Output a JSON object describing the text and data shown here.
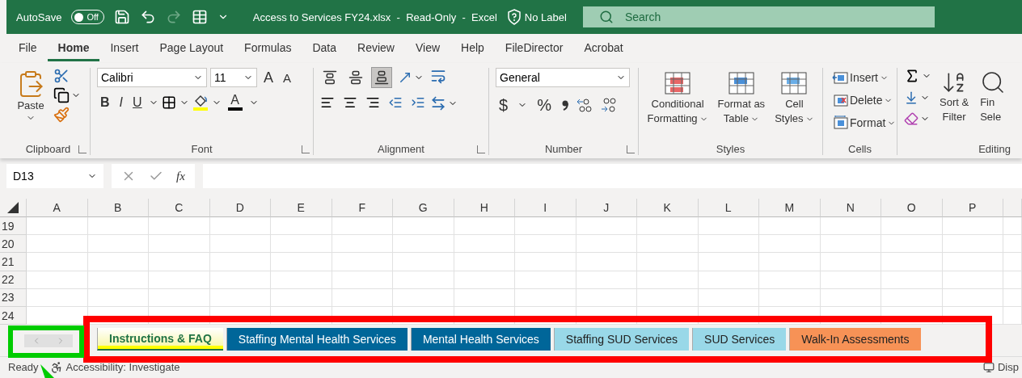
{
  "title_bar": {
    "autosave_label": "AutoSave",
    "autosave": {
      "label": "Off",
      "on": false
    },
    "title": "Access to Services FY24.xlsx  -  Read-Only  -  Excel",
    "sensitivity": "No Label",
    "search": {
      "placeholder": "Search"
    }
  },
  "menu_tabs": [
    {
      "label": "File",
      "selected": false
    },
    {
      "label": "Home",
      "selected": true
    },
    {
      "label": "Insert",
      "selected": false
    },
    {
      "label": "Page Layout",
      "selected": false
    },
    {
      "label": "Formulas",
      "selected": false
    },
    {
      "label": "Data",
      "selected": false
    },
    {
      "label": "Review",
      "selected": false
    },
    {
      "label": "View",
      "selected": false
    },
    {
      "label": "Help",
      "selected": false
    },
    {
      "label": "FileDirector",
      "selected": false
    },
    {
      "label": "Acrobat",
      "selected": false
    }
  ],
  "ribbon": {
    "clipboard": {
      "name": "Clipboard",
      "paste": "Paste",
      "dialog_launcher": true
    },
    "font": {
      "name": "Font",
      "font_name": "Calibri",
      "font_size": "11",
      "grow": "A",
      "shrink": "A",
      "bold": "B",
      "italic": "I",
      "underline": "U",
      "font_color": "A",
      "dialog_launcher": true
    },
    "alignment": {
      "name": "Alignment",
      "vertical": [
        {
          "kind": "top",
          "selected": false
        },
        {
          "kind": "middle",
          "selected": false
        },
        {
          "kind": "bottom",
          "selected": true
        }
      ],
      "dialog_launcher": true
    },
    "number": {
      "name": "Number",
      "format": "General",
      "currency": "$",
      "percent": "%",
      "dialog_launcher": true
    },
    "styles": {
      "name": "Styles",
      "buttons": [
        {
          "kind": "conditional",
          "lines": [
            "Conditional",
            "Formatting"
          ]
        },
        {
          "kind": "table",
          "lines": [
            "Format as",
            "Table"
          ]
        },
        {
          "kind": "cell",
          "lines": [
            "Cell",
            "Styles"
          ]
        }
      ]
    },
    "cells": {
      "name": "Cells",
      "buttons": [
        {
          "kind": "insert",
          "label": "Insert"
        },
        {
          "kind": "delete",
          "label": "Delete"
        },
        {
          "kind": "format",
          "label": "Format"
        }
      ]
    },
    "editing": {
      "name": "Editing",
      "sort": [
        "Sort &",
        "Filter"
      ],
      "find": [
        "Fin",
        "Sele"
      ]
    }
  },
  "formula_bar": {
    "name_box": "D13",
    "fx": "fx"
  },
  "grid": {
    "columns": [
      "A",
      "B",
      "C",
      "D",
      "E",
      "F",
      "G",
      "H",
      "I",
      "J",
      "K",
      "L",
      "M",
      "N",
      "O",
      "P"
    ],
    "rows": [
      "19",
      "20",
      "21",
      "22",
      "23",
      "24"
    ]
  },
  "sheet_tabs": [
    {
      "label": "Instructions & FAQ",
      "color": "#ffff00",
      "selected": true
    },
    {
      "label": "Staffing Mental Health Services",
      "color": "#006699",
      "selected": false
    },
    {
      "label": "Mental Health Services",
      "color": "#006699",
      "selected": false
    },
    {
      "label": "Staffing SUD Services",
      "color": "#99d8e8",
      "selected": false
    },
    {
      "label": "SUD Services",
      "color": "#99d8e8",
      "selected": false
    },
    {
      "label": "Walk-In Assessments",
      "color": "#f79256",
      "selected": false
    }
  ],
  "status_bar": {
    "state": "Ready",
    "accessibility": "Accessibility: Investigate",
    "right": "Disp"
  },
  "annotations": [
    {
      "kind": "box",
      "color": "#ff0000"
    },
    {
      "kind": "box",
      "color": "#00cc00"
    },
    {
      "kind": "arrow",
      "color": "#00cc00"
    }
  ]
}
